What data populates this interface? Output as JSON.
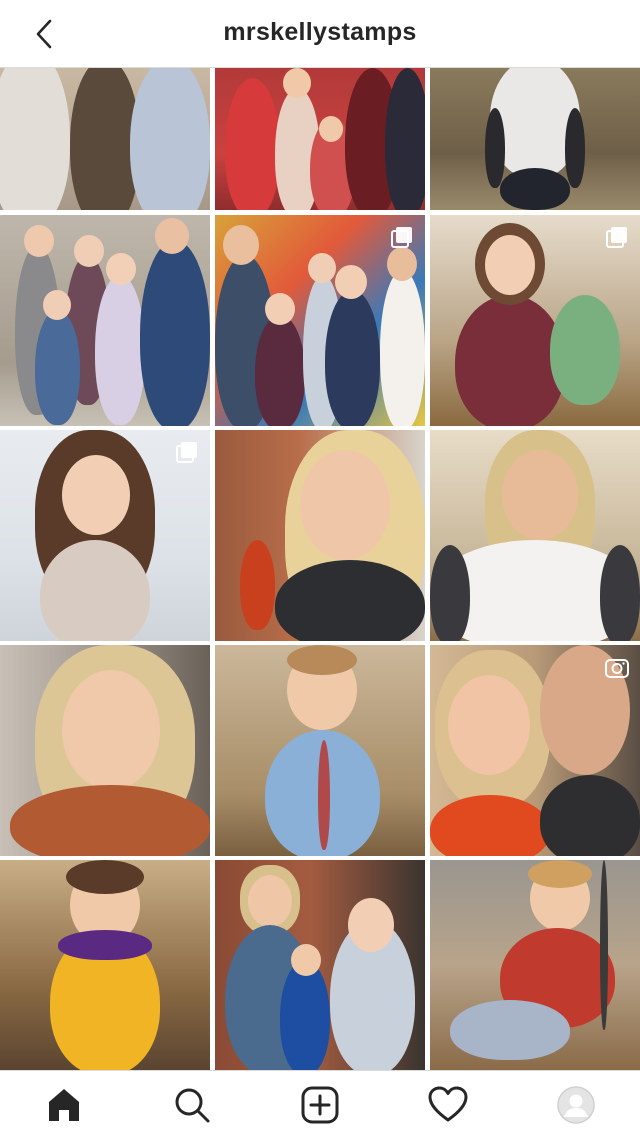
{
  "header": {
    "title": "mrskellystamps",
    "back_icon": "chevron-left-icon"
  },
  "grid": {
    "posts": [
      {
        "id": "p1",
        "type": "photo",
        "overlay": null
      },
      {
        "id": "p2",
        "type": "photo",
        "overlay": null
      },
      {
        "id": "p3",
        "type": "photo",
        "overlay": null
      },
      {
        "id": "p4",
        "type": "photo",
        "overlay": null
      },
      {
        "id": "p5",
        "type": "carousel",
        "overlay": "multiple-photos-icon"
      },
      {
        "id": "p6",
        "type": "carousel",
        "overlay": "multiple-photos-icon"
      },
      {
        "id": "p7",
        "type": "carousel",
        "overlay": "multiple-photos-icon"
      },
      {
        "id": "p8",
        "type": "photo",
        "overlay": null
      },
      {
        "id": "p9",
        "type": "photo",
        "overlay": null
      },
      {
        "id": "p10",
        "type": "photo",
        "overlay": null
      },
      {
        "id": "p11",
        "type": "photo",
        "overlay": null
      },
      {
        "id": "p12",
        "type": "video",
        "overlay": "video-camera-icon"
      },
      {
        "id": "p13",
        "type": "photo",
        "overlay": null
      },
      {
        "id": "p14",
        "type": "photo",
        "overlay": null
      },
      {
        "id": "p15",
        "type": "photo",
        "overlay": null
      }
    ]
  },
  "bottom_nav": {
    "items": [
      {
        "name": "home",
        "icon": "home-icon",
        "active": true
      },
      {
        "name": "search",
        "icon": "search-icon",
        "active": false
      },
      {
        "name": "new-post",
        "icon": "add-post-icon",
        "active": false
      },
      {
        "name": "activity",
        "icon": "heart-icon",
        "active": false
      },
      {
        "name": "profile",
        "icon": "profile-avatar-icon",
        "active": false
      }
    ]
  },
  "colors": {
    "text_primary": "#262626",
    "divider": "#dbdbdb",
    "background": "#ffffff"
  }
}
